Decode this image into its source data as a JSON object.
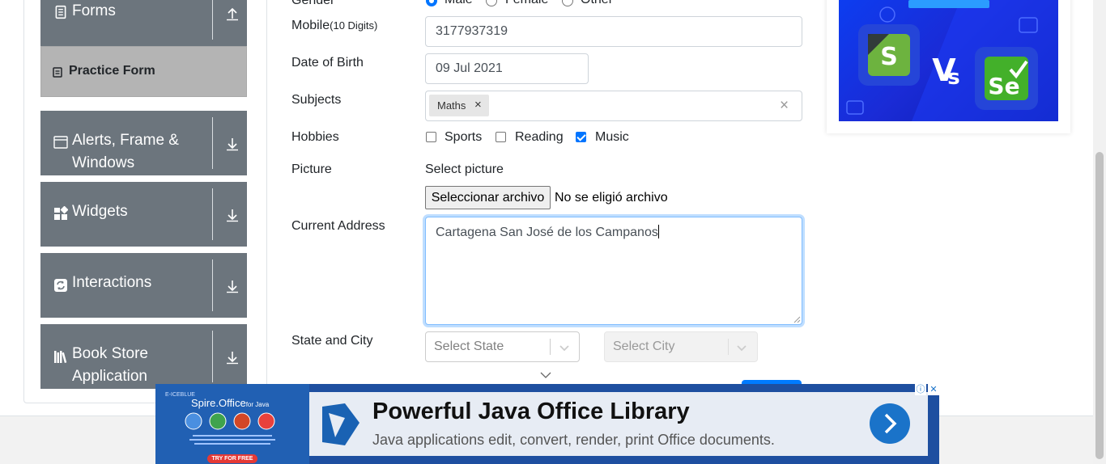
{
  "sidebar": {
    "forms": "Forms",
    "practice_form": "Practice Form",
    "alerts_line1": "Alerts, Frame &",
    "alerts_line2": "Windows",
    "widgets": "Widgets",
    "interactions": "Interactions",
    "bookstore_line1": "Book Store",
    "bookstore_line2": "Application"
  },
  "form": {
    "gender_label": "Gender",
    "gender_options": [
      "Male",
      "Female",
      "Other"
    ],
    "gender_selected": "Male",
    "mobile_label": "Mobile",
    "mobile_hint": "(10 Digits)",
    "mobile_value": "3177937319",
    "dob_label": "Date of Birth",
    "dob_value": "09 Jul 2021",
    "subjects_label": "Subjects",
    "subject_chips": [
      "Maths"
    ],
    "chip_remove": "×",
    "subjects_clear": "×",
    "hobbies_label": "Hobbies",
    "hobbies": [
      {
        "label": "Sports",
        "checked": false
      },
      {
        "label": "Reading",
        "checked": false
      },
      {
        "label": "Music",
        "checked": true
      }
    ],
    "picture_label": "Picture",
    "select_picture": "Select picture",
    "file_button": "Seleccionar archivo",
    "file_status": "No se eligió archivo",
    "address_label": "Current Address",
    "address_value": "Cartagena San José de los Campanos",
    "state_city_label": "State and City",
    "state_placeholder": "Select State",
    "city_placeholder": "Select City"
  },
  "bottom_ad": {
    "brand": "Spire.Office",
    "brand_suffix": "for Java",
    "try_label": "TRY FOR FREE",
    "title": "Powerful Java Office Library",
    "subtitle": "Java applications edit, convert, render, print Office documents.",
    "info": "ⓘ",
    "close": "✕"
  },
  "colors": {
    "sidebar_group": "#6c757d",
    "sidebar_active": "#b4b4b4",
    "accent": "#0075ff"
  }
}
